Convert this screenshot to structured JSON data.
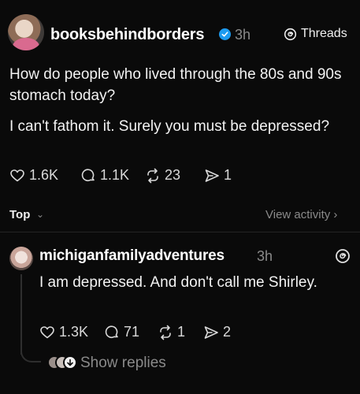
{
  "post": {
    "username": "booksbehindborders",
    "time": "3h",
    "threads_label": "Threads",
    "text_line1": "How do people who lived through the 80s and 90s stomach today?",
    "text_line2": "I can't fathom it. Surely you must be depressed?",
    "likes": "1.6K",
    "comments": "1.1K",
    "reposts": "23",
    "shares": "1",
    "icons": [
      "avatar",
      "verified-badge-icon",
      "threads-logo-icon",
      "heart-icon",
      "comment-icon",
      "repost-icon",
      "share-icon"
    ],
    "accent_color": "#1d9bf0"
  },
  "sort_bar": {
    "top_label": "Top",
    "view_activity": "View activity"
  },
  "reply": {
    "username": "michiganfamilyadventures",
    "time": "3h",
    "text": "I am depressed. And don't call me Shirley.",
    "likes": "1.3K",
    "comments": "71",
    "reposts": "1",
    "shares": "2",
    "show_replies": "Show replies"
  }
}
